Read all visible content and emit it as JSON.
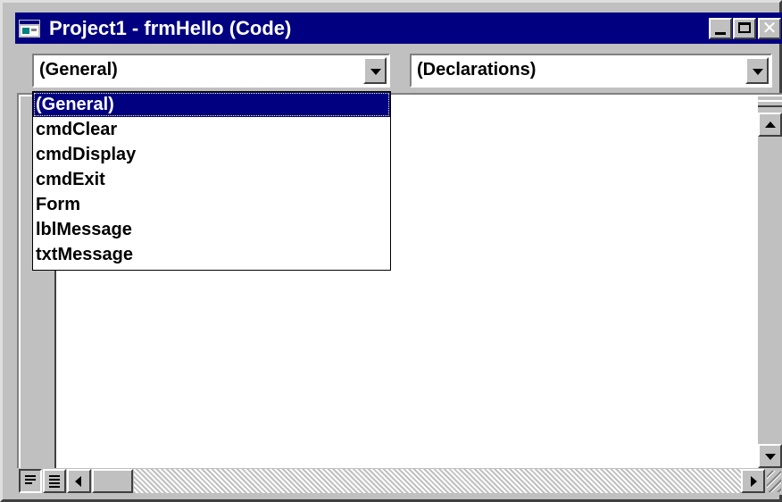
{
  "window": {
    "title": "Project1 - frmHello (Code)"
  },
  "combos": {
    "object": {
      "value": "(General)"
    },
    "procedure": {
      "value": "(Declarations)"
    }
  },
  "dropdown": {
    "items": [
      {
        "label": "(General)",
        "selected": true
      },
      {
        "label": "cmdClear",
        "selected": false
      },
      {
        "label": "cmdDisplay",
        "selected": false
      },
      {
        "label": "cmdExit",
        "selected": false
      },
      {
        "label": "Form",
        "selected": false
      },
      {
        "label": "lblMessage",
        "selected": false
      },
      {
        "label": "txtMessage",
        "selected": false
      }
    ]
  },
  "icons": {
    "app": "form-icon",
    "minimize": "minimize-icon",
    "maximize": "maximize-icon",
    "close": "close-icon",
    "procedure_view": "procedure-view-icon",
    "full_module_view": "full-module-view-icon"
  },
  "colors": {
    "titlebar": "#000080",
    "face": "#c0c0c0",
    "selection": "#000080"
  }
}
